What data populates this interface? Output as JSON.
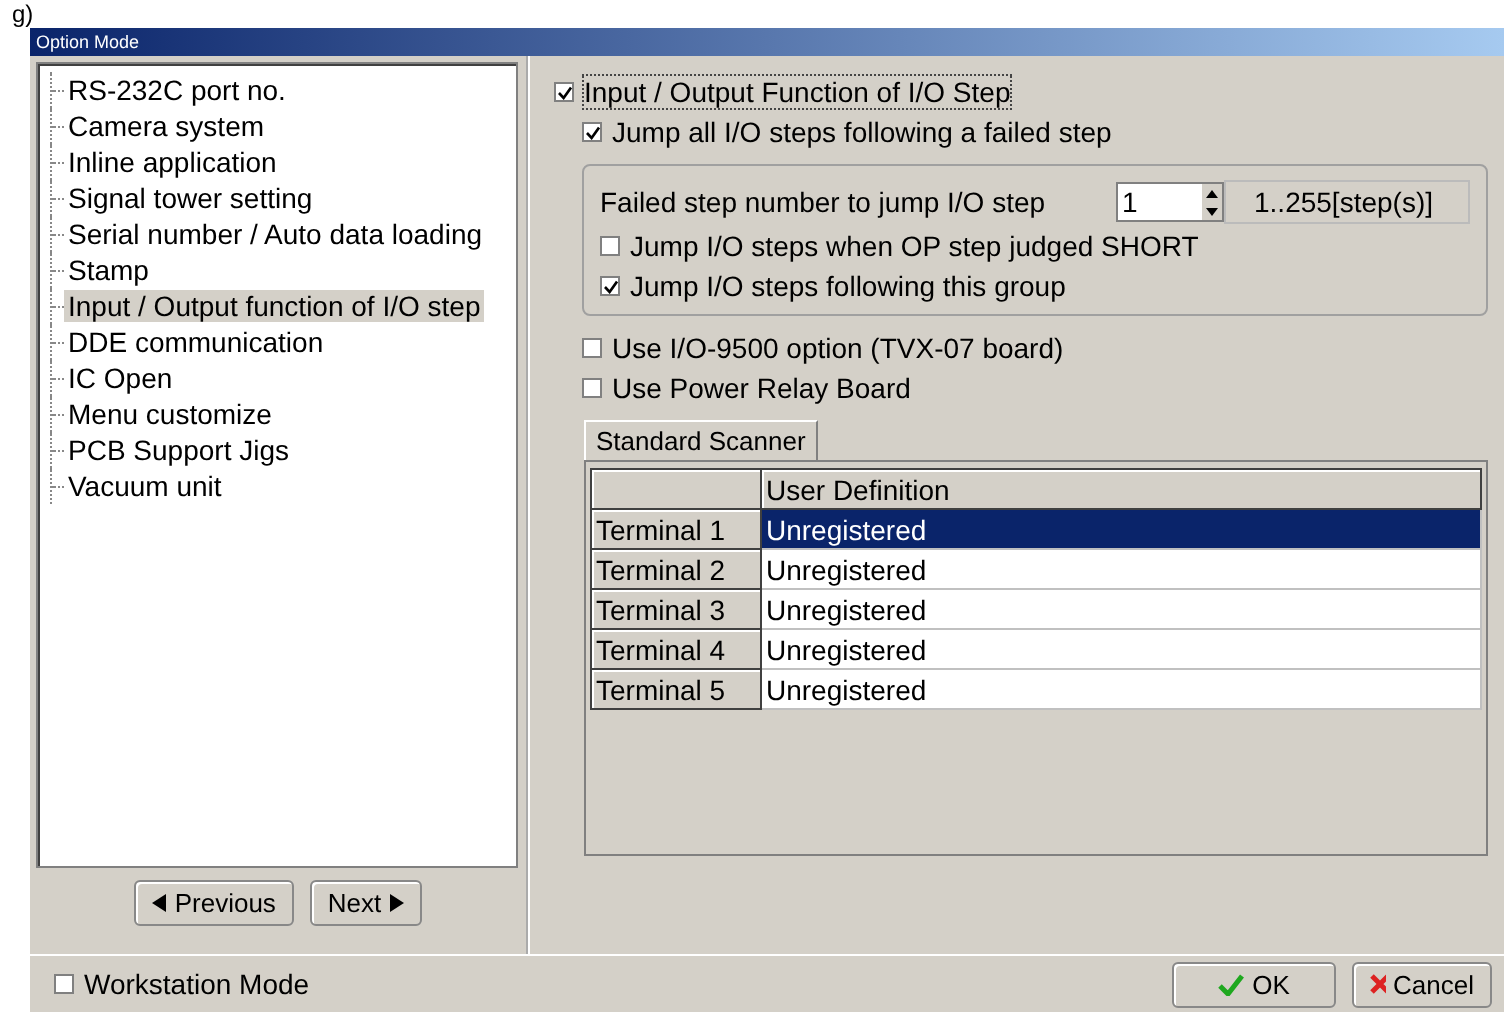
{
  "page_fragment": "g)",
  "window": {
    "title": "Option Mode"
  },
  "tree": {
    "items": [
      {
        "label": "RS-232C port no.",
        "selected": false
      },
      {
        "label": "Camera system",
        "selected": false
      },
      {
        "label": "Inline application",
        "selected": false
      },
      {
        "label": "Signal tower setting",
        "selected": false
      },
      {
        "label": "Serial number / Auto data loading",
        "selected": false
      },
      {
        "label": "Stamp",
        "selected": false
      },
      {
        "label": "Input / Output function of I/O step",
        "selected": true
      },
      {
        "label": "DDE communication",
        "selected": false
      },
      {
        "label": "IC Open",
        "selected": false
      },
      {
        "label": "Menu customize",
        "selected": false
      },
      {
        "label": "PCB Support Jigs",
        "selected": false
      },
      {
        "label": "Vacuum unit",
        "selected": false
      }
    ]
  },
  "nav_buttons": [
    {
      "label": "Previous",
      "kind": "previous"
    },
    {
      "label": "Next",
      "kind": "next"
    }
  ],
  "main_option": {
    "label": "Input / Output Function of I/O Step",
    "checked": true
  },
  "jump_all": {
    "label": "Jump all I/O steps following a failed step",
    "checked": true
  },
  "group": {
    "field_label": "Failed step number to jump I/O step",
    "value": "1",
    "range": "1..255[step(s)]",
    "options": [
      {
        "label": "Jump I/O steps when OP step judged SHORT",
        "checked": false
      },
      {
        "label": "Jump I/O steps following this group",
        "checked": true
      }
    ]
  },
  "options": [
    {
      "label": "Use I/O-9500 option (TVX-07 board)",
      "checked": false
    },
    {
      "label": "Use Power Relay Board",
      "checked": false
    }
  ],
  "tabs": [
    {
      "label": "Standard Scanner",
      "selected": true
    }
  ],
  "table": {
    "columns": [
      "User Definition"
    ],
    "rows": [
      {
        "header": "Terminal 1",
        "value": "Unregistered",
        "selected": true
      },
      {
        "header": "Terminal 2",
        "value": "Unregistered",
        "selected": false
      },
      {
        "header": "Terminal 3",
        "value": "Unregistered",
        "selected": false
      },
      {
        "header": "Terminal 4",
        "value": "Unregistered",
        "selected": false
      },
      {
        "header": "Terminal 5",
        "value": "Unregistered",
        "selected": false
      }
    ]
  },
  "workstation_mode": {
    "label": "Workstation Mode",
    "checked": false
  },
  "buttons": [
    {
      "label": "OK",
      "kind": "ok"
    },
    {
      "label": "Cancel",
      "kind": "cancel"
    }
  ]
}
